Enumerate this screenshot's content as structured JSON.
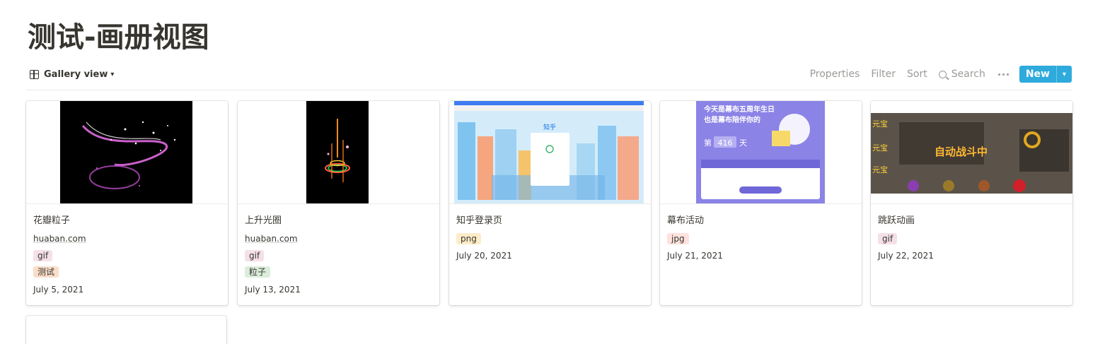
{
  "page": {
    "title": "测试-画册视图"
  },
  "toolbar": {
    "view_label": "Gallery view",
    "properties": "Properties",
    "filter": "Filter",
    "sort": "Sort",
    "search": "Search",
    "new_label": "New",
    "accent": "#2eaadc"
  },
  "cards": [
    {
      "name": "花瓣粒子",
      "url": "huaban.com",
      "tags": [
        "gif",
        "测试"
      ],
      "date": "July 5, 2021"
    },
    {
      "name": "上升光圈",
      "url": "huaban.com",
      "tags": [
        "gif",
        "粒子"
      ],
      "date": "July 13, 2021"
    },
    {
      "name": "知乎登录页",
      "tags": [
        "png"
      ],
      "date": "July 20, 2021",
      "cover_text": "知乎"
    },
    {
      "name": "幕布活动",
      "tags": [
        "jpg"
      ],
      "date": "July 21, 2021",
      "cover_text": {
        "line1": "今天是幕布五周年生日",
        "line2": "也是幕布陪伴你的",
        "prefix": "第",
        "days": "416",
        "suffix": "天"
      }
    },
    {
      "name": "跳跃动画",
      "tags": [
        "gif"
      ],
      "date": "July 22, 2021",
      "cover_text": {
        "left1": "元宝",
        "left2": "元宝",
        "left3": "元宝",
        "banner": "自动战斗中"
      }
    }
  ]
}
